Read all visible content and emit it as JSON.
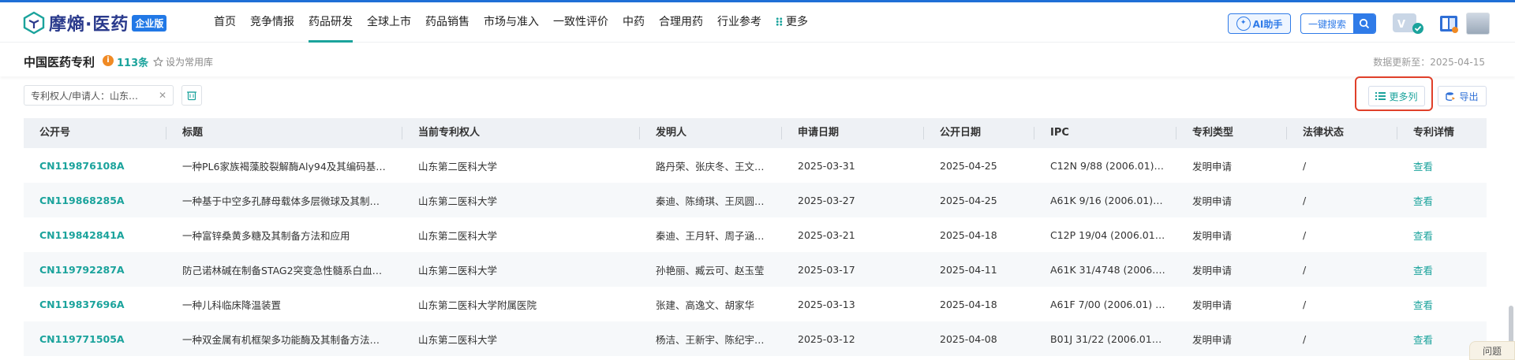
{
  "brand": {
    "name": "摩熵·医药",
    "badge": "企业版"
  },
  "nav": {
    "items": [
      "首页",
      "竞争情报",
      "药品研发",
      "全球上市",
      "药品销售",
      "市场与准入",
      "一致性评价",
      "中药",
      "合理用药",
      "行业参考"
    ],
    "more": "更多",
    "active": "药品研发"
  },
  "header": {
    "ai_label": "AI助手",
    "search_label": "一键搜索"
  },
  "page": {
    "title": "中国医药专利",
    "count": "113条",
    "favorite": "设为常用库",
    "updated": "数据更新至：2025-04-15"
  },
  "filter": {
    "chip_label": "专利权人/申请人：山东…",
    "more_columns": "更多列",
    "export": "导出"
  },
  "table": {
    "columns": [
      "公开号",
      "标题",
      "当前专利权人",
      "发明人",
      "申请日期",
      "公开日期",
      "IPC",
      "专利类型",
      "法律状态",
      "专利详情"
    ],
    "rows": [
      [
        "CN119876108A",
        "一种PL6家族褐藻胶裂解酶Aly94及其编码基…",
        "山东第二医科大学",
        "路丹荣、张庆冬、王文…",
        "2025-03-31",
        "2025-04-25",
        "C12N 9/88 (2006.01) | …",
        "发明申请",
        "/",
        "查看"
      ],
      [
        "CN119868285A",
        "一种基于中空多孔酵母载体多层微球及其制…",
        "山东第二医科大学",
        "秦迪、陈绮琪、王凤圆…",
        "2025-03-27",
        "2025-04-25",
        "A61K 9/16 (2006.01) | …",
        "发明申请",
        "/",
        "查看"
      ],
      [
        "CN119842841A",
        "一种富锌桑黄多糖及其制备方法和应用",
        "山东第二医科大学",
        "秦迪、王月轩、周子涵…",
        "2025-03-21",
        "2025-04-18",
        "C12P 19/04 (2006.01) |…",
        "发明申请",
        "/",
        "查看"
      ],
      [
        "CN119792287A",
        "防己诺林碱在制备STAG2突变急性髓系白血…",
        "山东第二医科大学",
        "孙艳丽、臧云可、赵玉莹",
        "2025-03-17",
        "2025-04-11",
        "A61K 31/4748 (2006.0…",
        "发明申请",
        "/",
        "查看"
      ],
      [
        "CN119837696A",
        "一种儿科临床降温装置",
        "山东第二医科大学附属医院",
        "张建、高逸文、胡家华",
        "2025-03-13",
        "2025-04-18",
        "A61F 7/00 (2006.01) | A…",
        "发明申请",
        "/",
        "查看"
      ],
      [
        "CN119771505A",
        "一种双金属有机框架多功能酶及其制备方法…",
        "山东第二医科大学",
        "杨洁、王新宇、陈纪宇…",
        "2025-03-12",
        "2025-04-08",
        "B01J 31/22 (2006.01) | …",
        "发明申请",
        "/",
        "查看"
      ]
    ]
  },
  "help": {
    "label": "问题"
  },
  "colors": {
    "accent": "#1ba39c",
    "brand_blue": "#2f7be8",
    "highlight": "#e0402a"
  }
}
